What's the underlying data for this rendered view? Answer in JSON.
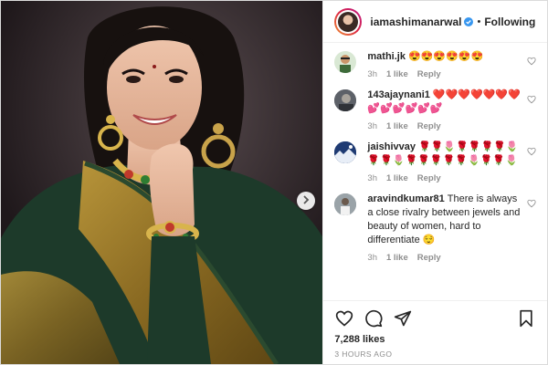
{
  "post": {
    "author": {
      "username": "iamashimanarwal",
      "verified": true,
      "separator": "•",
      "follow_label": "Following"
    },
    "comments": [
      {
        "username": "mathi.jk",
        "text": "😍😍😍😍😍😍",
        "time": "3h",
        "likes": "1 like",
        "reply": "Reply",
        "avatar_color": "#d9e8d4"
      },
      {
        "username": "143ajaynani1",
        "text": "❤️❤️❤️❤️❤️❤️❤️💕💕💕💕💕💕",
        "time": "3h",
        "likes": "1 like",
        "reply": "Reply",
        "avatar_color": "#7a7e86"
      },
      {
        "username": "jaishivvay",
        "text": "🌹🌹🌷🌹🌹🌹🌹🌷🌹🌹🌷🌹🌹🌹🌹🌹🌷🌹🌹🌷",
        "time": "3h",
        "likes": "1 like",
        "reply": "Reply",
        "avatar_color": "#1f3b73"
      },
      {
        "username": "aravindkumar81",
        "text": "There is always a close rivalry between jewels and beauty of women, hard to differentiate 😌",
        "time": "3h",
        "likes": "1 like",
        "reply": "Reply",
        "avatar_color": "#8a939a"
      }
    ],
    "like_count": "7,288 likes",
    "time_ago": "3 hours ago",
    "icons": {
      "like": "heart-icon",
      "comment": "comment-icon",
      "share": "share-icon",
      "save": "bookmark-icon",
      "next": "chevron-right-icon"
    },
    "colors": {
      "verified": "#3897f0",
      "saree_gold": "#9a7a2a",
      "blouse_green": "#1d3a2a"
    }
  }
}
